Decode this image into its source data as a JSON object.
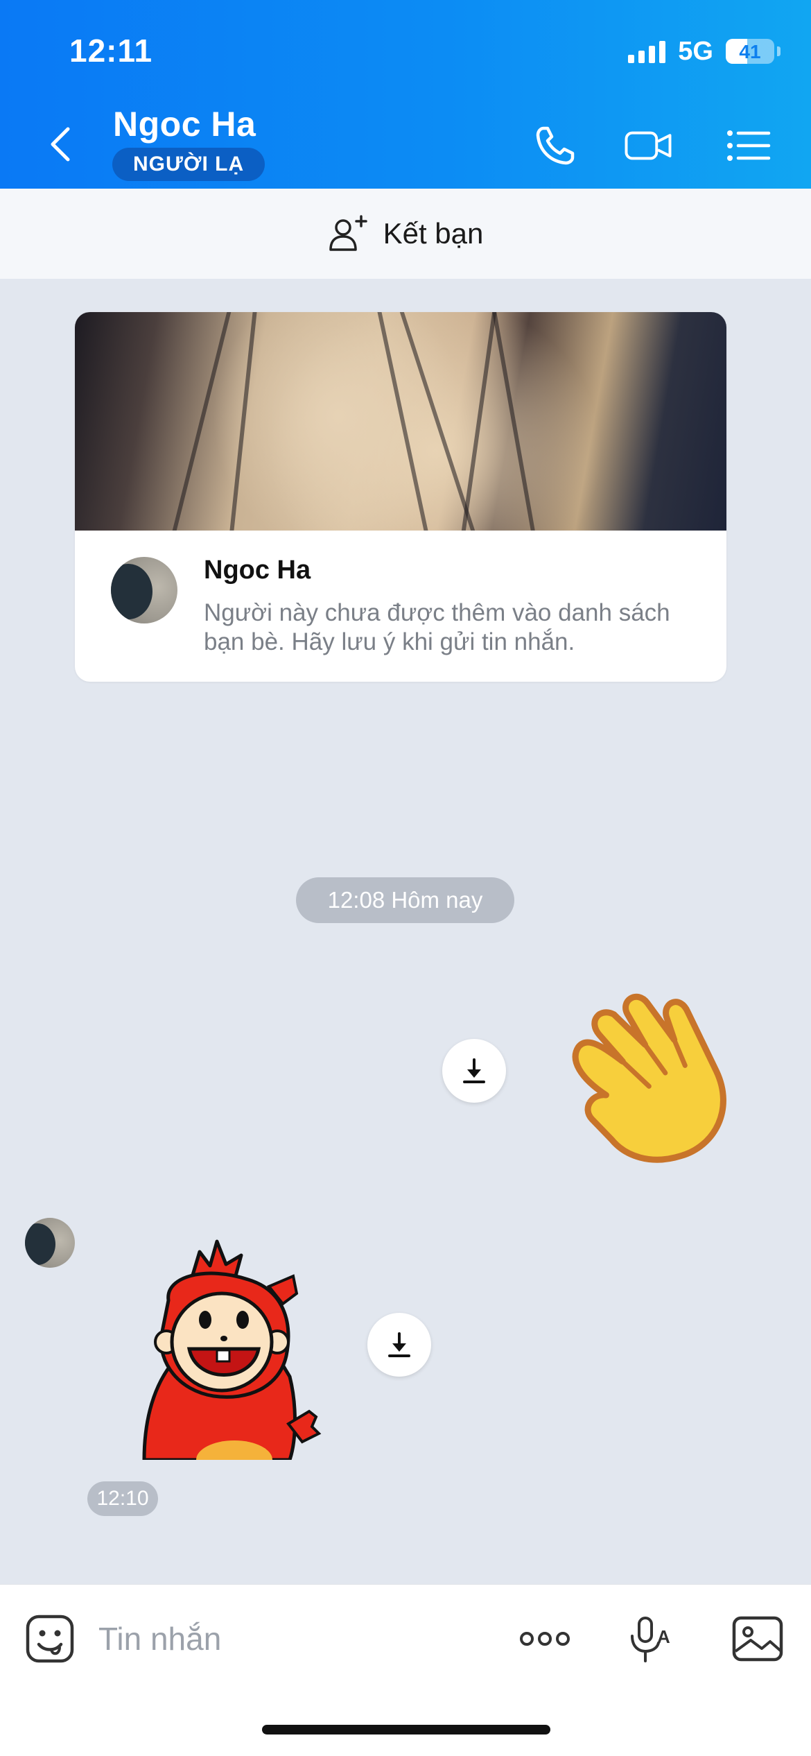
{
  "status_bar": {
    "time": "12:11",
    "network": "5G",
    "battery_level": "41",
    "battery_fraction": 0.41
  },
  "header": {
    "contact_name": "Ngoc Ha",
    "badge": "NGƯỜI LẠ",
    "icons": [
      "back-icon",
      "phone-icon",
      "video-camera-icon",
      "list-menu-icon"
    ]
  },
  "add_friend": {
    "label": "Kết bạn",
    "icon": "add-person-icon"
  },
  "profile_card": {
    "name": "Ngoc Ha",
    "description": "Người này chưa được thêm vào danh sách bạn bè. Hãy lưu ý khi gửi tin nhắn."
  },
  "conversation": {
    "date_separator": "12:08 Hôm nay",
    "messages": [
      {
        "sender": "me",
        "type": "sticker",
        "sticker": "waving-hand"
      },
      {
        "sender": "contact",
        "type": "sticker",
        "sticker": "red-monkey-waving",
        "time": "12:10"
      }
    ]
  },
  "input_bar": {
    "placeholder": "Tin nhắn",
    "value": "",
    "icons": [
      "emoji-icon",
      "more-icon",
      "voice-to-text-icon",
      "image-icon"
    ]
  },
  "colors": {
    "header_start": "#0a79f5",
    "header_end": "#11a6f2",
    "badge": "#0b5fc4",
    "chat_background": "#e2e7ef",
    "pill": "#b8bec8"
  }
}
